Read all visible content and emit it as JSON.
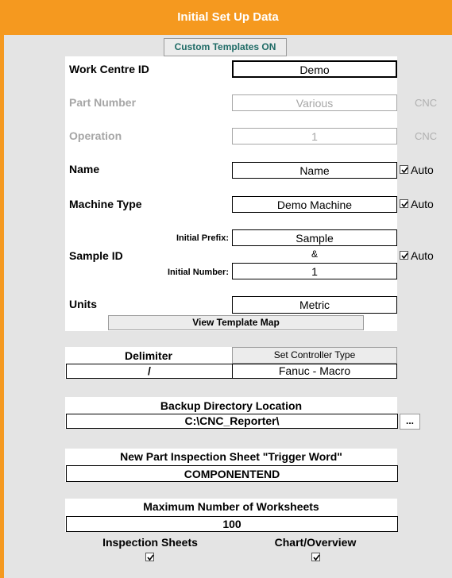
{
  "header": {
    "title": "Initial Set Up Data"
  },
  "custom_templates_button": "Custom Templates ON",
  "work_centre": {
    "label": "Work Centre ID",
    "value": "Demo"
  },
  "part_number": {
    "label": "Part Number",
    "value": "Various",
    "source": "CNC"
  },
  "operation": {
    "label": "Operation",
    "value": "1",
    "source": "CNC"
  },
  "name": {
    "label": "Name",
    "value": "Name",
    "auto_label": "Auto",
    "auto_checked": true
  },
  "machine_type": {
    "label": "Machine Type",
    "value": "Demo Machine",
    "auto_label": "Auto",
    "auto_checked": true
  },
  "sample_id": {
    "label": "Sample ID",
    "prefix_label": "Initial Prefix:",
    "prefix_value": "Sample",
    "separator": "&",
    "number_label": "Initial Number:",
    "number_value": "1",
    "auto_label": "Auto",
    "auto_checked": true
  },
  "units": {
    "label": "Units",
    "value": "Metric"
  },
  "view_template_map_button": "View Template Map",
  "delimiter": {
    "label": "Delimiter",
    "value": "/"
  },
  "controller": {
    "button": "Set Controller Type",
    "value": "Fanuc - Macro"
  },
  "backup": {
    "label": "Backup Directory Location",
    "value": "C:\\CNC_Reporter\\",
    "browse": "..."
  },
  "trigger": {
    "label": "New Part Inspection Sheet \"Trigger Word\"",
    "value": "COMPONENTEND"
  },
  "worksheets": {
    "label": "Maximum Number of Worksheets",
    "value": "100",
    "inspection_label": "Inspection Sheets",
    "inspection_checked": true,
    "chart_label": "Chart/Overview",
    "chart_checked": true
  }
}
